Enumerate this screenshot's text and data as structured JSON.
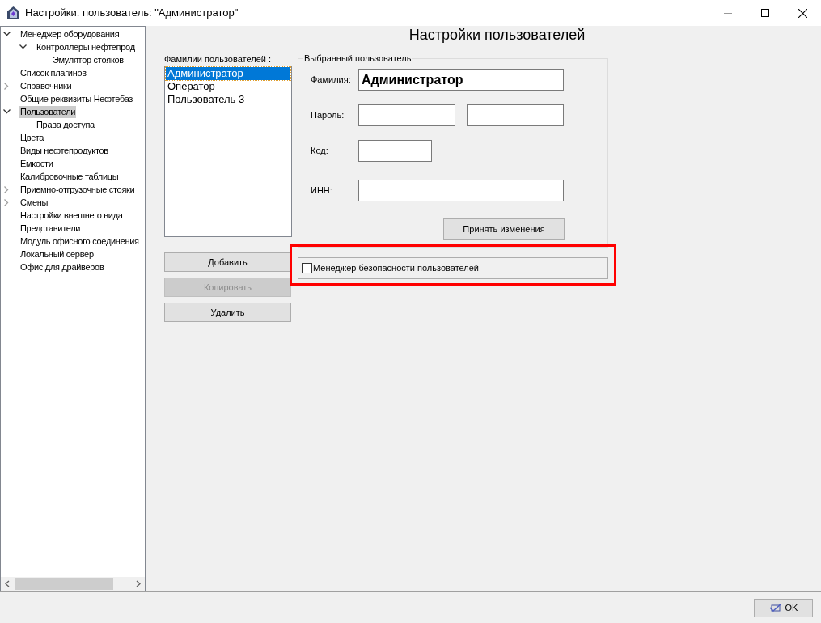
{
  "window": {
    "title": "Настройки. пользователь: \"Администратор\""
  },
  "tree": [
    {
      "label": "Менеджер оборудования",
      "expanded": true,
      "selected": false,
      "children": [
        {
          "label": "Контроллеры нефтепрод",
          "expanded": true,
          "selected": false,
          "children": [
            {
              "label": "Эмулятор стояков",
              "selected": false
            }
          ]
        }
      ]
    },
    {
      "label": "Список плагинов",
      "selected": false
    },
    {
      "label": "Справочники",
      "expanded": false,
      "selected": false
    },
    {
      "label": "Общие реквизиты Нефтебаз",
      "selected": false
    },
    {
      "label": "Пользователи",
      "expanded": true,
      "selected": true,
      "children": [
        {
          "label": "Права доступа",
          "selected": false
        }
      ]
    },
    {
      "label": "Цвета",
      "selected": false
    },
    {
      "label": "Виды нефтепродуктов",
      "selected": false
    },
    {
      "label": "Емкости",
      "selected": false
    },
    {
      "label": "Калибровочные таблицы",
      "selected": false
    },
    {
      "label": "Приемно-отгрузочные стояки",
      "expanded": false,
      "selected": false
    },
    {
      "label": "Смены",
      "expanded": false,
      "selected": false
    },
    {
      "label": "Настройки внешнего вида",
      "selected": false
    },
    {
      "label": "Представители",
      "selected": false
    },
    {
      "label": "Модуль офисного соединения",
      "selected": false
    },
    {
      "label": "Локальный сервер",
      "selected": false
    },
    {
      "label": "Офис для драйверов",
      "selected": false
    }
  ],
  "heading": "Настройки пользователей",
  "users": {
    "label": "Фамилии пользователей :",
    "items": [
      {
        "label": "Администратор",
        "selected": true
      },
      {
        "label": "Оператор",
        "selected": false
      },
      {
        "label": "Пользователь 3",
        "selected": false
      }
    ],
    "buttons": [
      {
        "label": "Добавить",
        "disabled": false
      },
      {
        "label": "Копировать",
        "disabled": true
      },
      {
        "label": "Удалить",
        "disabled": false
      }
    ]
  },
  "selected_user": {
    "legend": "Выбранный пользователь",
    "surname_label": "Фамилия:",
    "surname": "Администратор",
    "password_label": "Пароль:",
    "code_label": "Код:",
    "inn_label": "ИНН:",
    "apply_button": "Принять изменения"
  },
  "security_manager": {
    "label": "Менеджер безопасности пользователей",
    "checked": false,
    "highlighted": true
  },
  "ok_button": "OK"
}
